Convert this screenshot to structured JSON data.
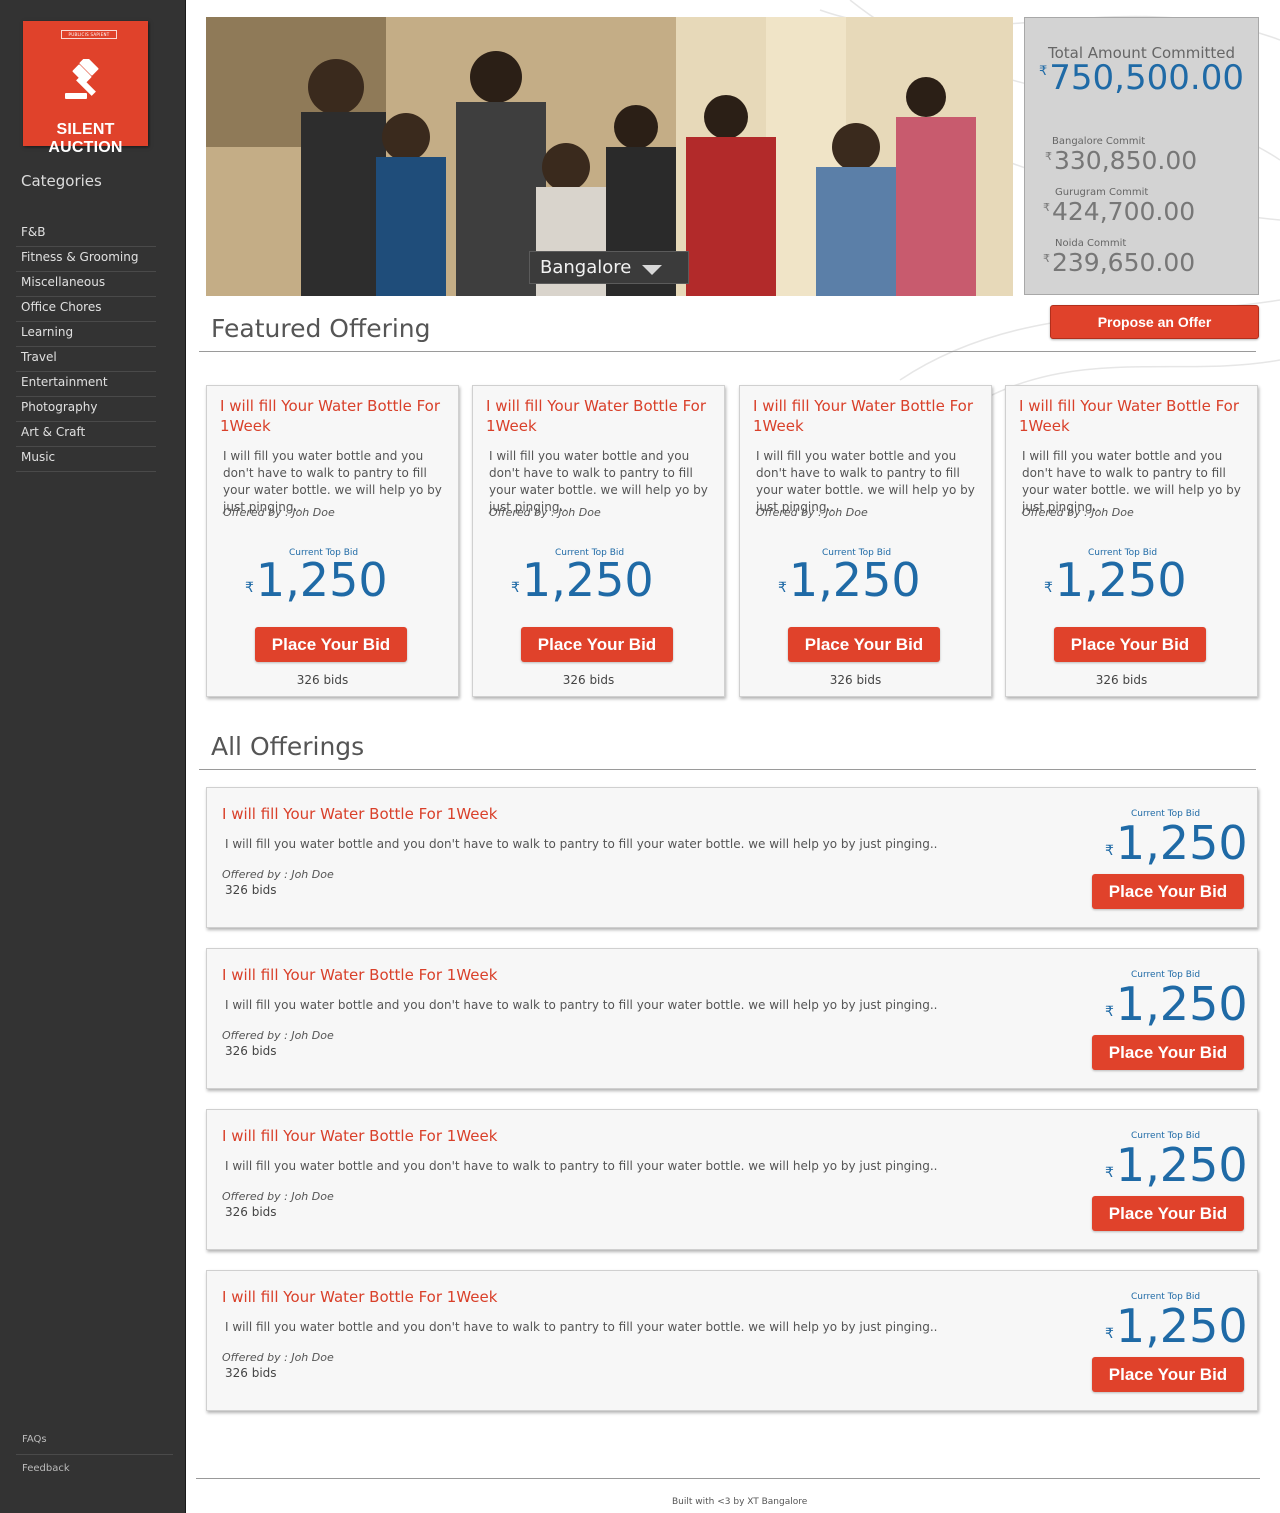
{
  "brand": {
    "top_label": "PUBLICIS SAPIENT",
    "name": "SILENT AUCTION"
  },
  "sidebar": {
    "title": "Categories",
    "items": [
      "F&B",
      "Fitness & Grooming",
      "Miscellaneous",
      "Office Chores",
      "Learning",
      "Travel",
      "Entertainment",
      "Photography",
      "Art & Craft",
      "Music"
    ],
    "footer": [
      "FAQs",
      "Feedback"
    ]
  },
  "hero": {
    "city": "Bangalore"
  },
  "commit": {
    "total_label": "Total Amount Committed",
    "total_value": "750,500.00",
    "currency": "₹",
    "cities": [
      {
        "label": "Bangalore Commit",
        "value": "330,850.00"
      },
      {
        "label": "Gurugram Commit",
        "value": "424,700.00"
      },
      {
        "label": "Noida Commit",
        "value": "239,650.00"
      }
    ]
  },
  "actions": {
    "propose": "Propose an Offer"
  },
  "featured": {
    "title": "Featured Offering",
    "items": [
      {
        "title": "I will fill Your Water Bottle For 1Week",
        "desc": "I will fill you water bottle and you don't have to walk to pantry to fill your water bottle. we will help yo by just pinging..",
        "offered_by": "Offered by : Joh Doe",
        "bid_label": "Current Top Bid",
        "bid": "1,250",
        "button": "Place Your Bid",
        "bids": "326 bids"
      },
      {
        "title": "I will fill Your Water Bottle For 1Week",
        "desc": "I will fill you water bottle and you don't have to walk to pantry to fill your water bottle. we will help yo by just pinging..",
        "offered_by": "Offered by : Joh Doe",
        "bid_label": "Current Top Bid",
        "bid": "1,250",
        "button": "Place Your Bid",
        "bids": "326 bids"
      },
      {
        "title": "I will fill Your Water Bottle For 1Week",
        "desc": "I will fill you water bottle and you don't have to walk to pantry to fill your water bottle. we will help yo by just pinging..",
        "offered_by": "Offered by : Joh Doe",
        "bid_label": "Current Top Bid",
        "bid": "1,250",
        "button": "Place Your Bid",
        "bids": "326 bids"
      },
      {
        "title": "I will fill Your Water Bottle For 1Week",
        "desc": "I will fill you water bottle and you don't have to walk to pantry to fill your water bottle. we will help yo by just pinging..",
        "offered_by": "Offered by : Joh Doe",
        "bid_label": "Current Top Bid",
        "bid": "1,250",
        "button": "Place Your Bid",
        "bids": "326 bids"
      }
    ]
  },
  "all": {
    "title": "All Offerings",
    "items": [
      {
        "title": "I will fill Your Water Bottle For 1Week",
        "desc": "I will fill you water bottle and you don't have to walk to pantry to fill your water bottle. we will help yo by just pinging..",
        "offered_by": "Offered by : Joh Doe",
        "bids": "326 bids",
        "bid_label": "Current Top Bid",
        "bid": "1,250",
        "button": "Place Your Bid"
      },
      {
        "title": "I will fill Your Water Bottle For 1Week",
        "desc": "I will fill you water bottle and you don't have to walk to pantry to fill your water bottle. we will help yo by just pinging..",
        "offered_by": "Offered by : Joh Doe",
        "bids": "326 bids",
        "bid_label": "Current Top Bid",
        "bid": "1,250",
        "button": "Place Your Bid"
      },
      {
        "title": "I will fill Your Water Bottle For 1Week",
        "desc": "I will fill you water bottle and you don't have to walk to pantry to fill your water bottle. we will help yo by just pinging..",
        "offered_by": "Offered by : Joh Doe",
        "bids": "326 bids",
        "bid_label": "Current Top Bid",
        "bid": "1,250",
        "button": "Place Your Bid"
      },
      {
        "title": "I will fill Your Water Bottle For 1Week",
        "desc": "I will fill you water bottle and you don't have to walk to pantry to fill your water bottle. we will help yo by just pinging..",
        "offered_by": "Offered by : Joh Doe",
        "bids": "326 bids",
        "bid_label": "Current Top Bid",
        "bid": "1,250",
        "button": "Place Your Bid"
      }
    ]
  },
  "footer": {
    "text": "Built with  <3 by XT Bangalore"
  },
  "colors": {
    "accent": "#e0422b",
    "bid_blue": "#1f6aa6",
    "sidebar": "#333333"
  },
  "icons": {
    "logo": "gavel-icon",
    "city_dropdown": "caret-down-icon"
  }
}
